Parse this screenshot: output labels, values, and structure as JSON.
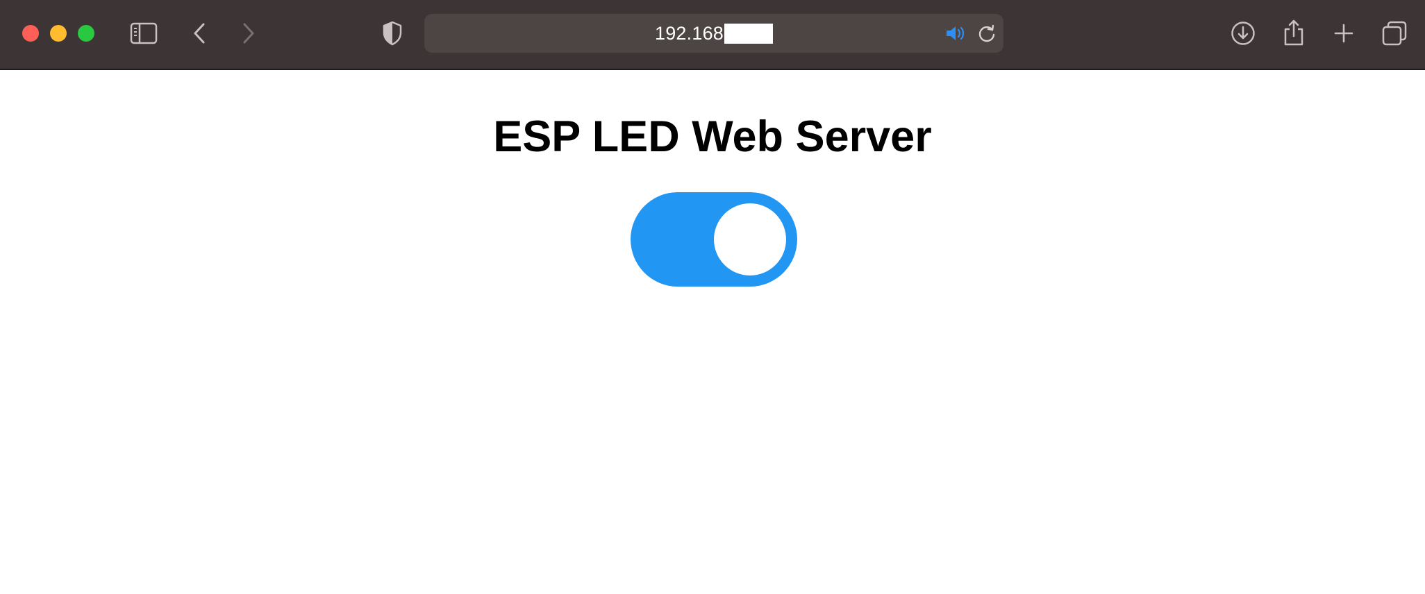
{
  "browser": {
    "url_text": "192.168",
    "icons": [
      "sidebar-icon",
      "back-icon",
      "forward-icon",
      "privacy-shield-icon",
      "audio-playing-icon",
      "reload-icon",
      "downloads-icon",
      "share-icon",
      "new-tab-icon",
      "tab-overview-icon"
    ],
    "colors": {
      "toolbar": "#3d3535",
      "urlbar": "#4d4444",
      "close": "#fe5f57",
      "minimize": "#febc2e",
      "maximize": "#28c840",
      "audio_icon": "#2d8ef5"
    }
  },
  "page": {
    "title": "ESP LED Web Server",
    "led_switch": {
      "state": "on",
      "color": "#2196f3"
    }
  }
}
